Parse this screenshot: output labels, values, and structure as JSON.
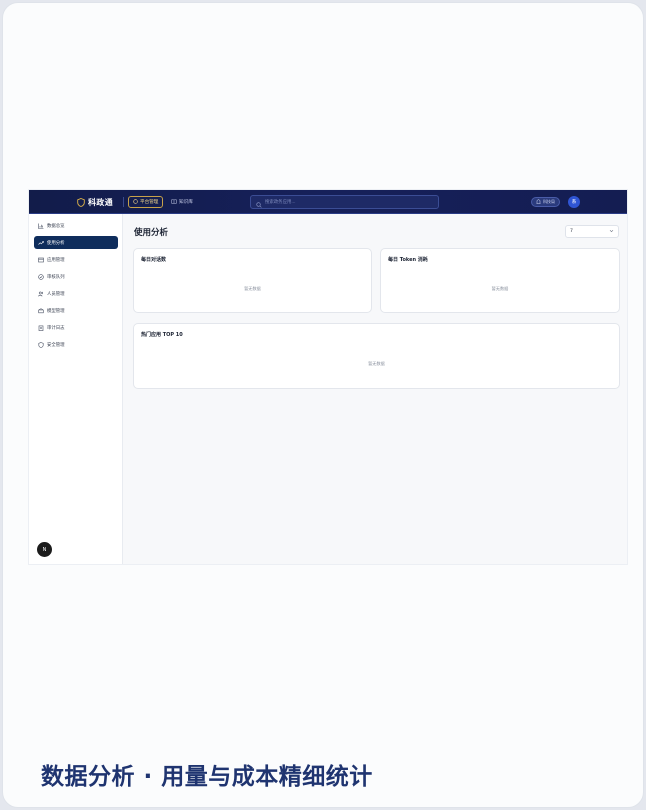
{
  "topbar": {
    "brand": "科政通",
    "nav_platform": "平台管理",
    "nav_knowledge": "知识库",
    "search_placeholder": "搜索政务应用...",
    "user_chip": "科技局",
    "avatar": "系"
  },
  "sidebar": {
    "items": [
      {
        "label": "数据总览",
        "icon": "bar-chart-icon"
      },
      {
        "label": "使用分析",
        "icon": "trend-line-icon",
        "active": true
      },
      {
        "label": "应用管理",
        "icon": "window-icon"
      },
      {
        "label": "审核队列",
        "icon": "check-circle-icon"
      },
      {
        "label": "人员管理",
        "icon": "users-icon"
      },
      {
        "label": "模型管理",
        "icon": "box-icon"
      },
      {
        "label": "审计日志",
        "icon": "clipboard-icon"
      },
      {
        "label": "安全管理",
        "icon": "shield-icon"
      }
    ],
    "badge": "N"
  },
  "main": {
    "title": "使用分析",
    "range_select": "7",
    "panels": [
      {
        "title": "每日对话数",
        "empty": "暂无数据"
      },
      {
        "title": "每日 Token 消耗",
        "empty": "暂无数据"
      },
      {
        "title": "热门应用 TOP 10",
        "empty": "暂无数据"
      }
    ]
  },
  "caption": "数据分析 · 用量与成本精细统计",
  "colors": {
    "topbar": "#141d52",
    "accent_gold": "#c8a24a",
    "sidebar_active": "#0f2d5c",
    "caption": "#1f3470"
  }
}
